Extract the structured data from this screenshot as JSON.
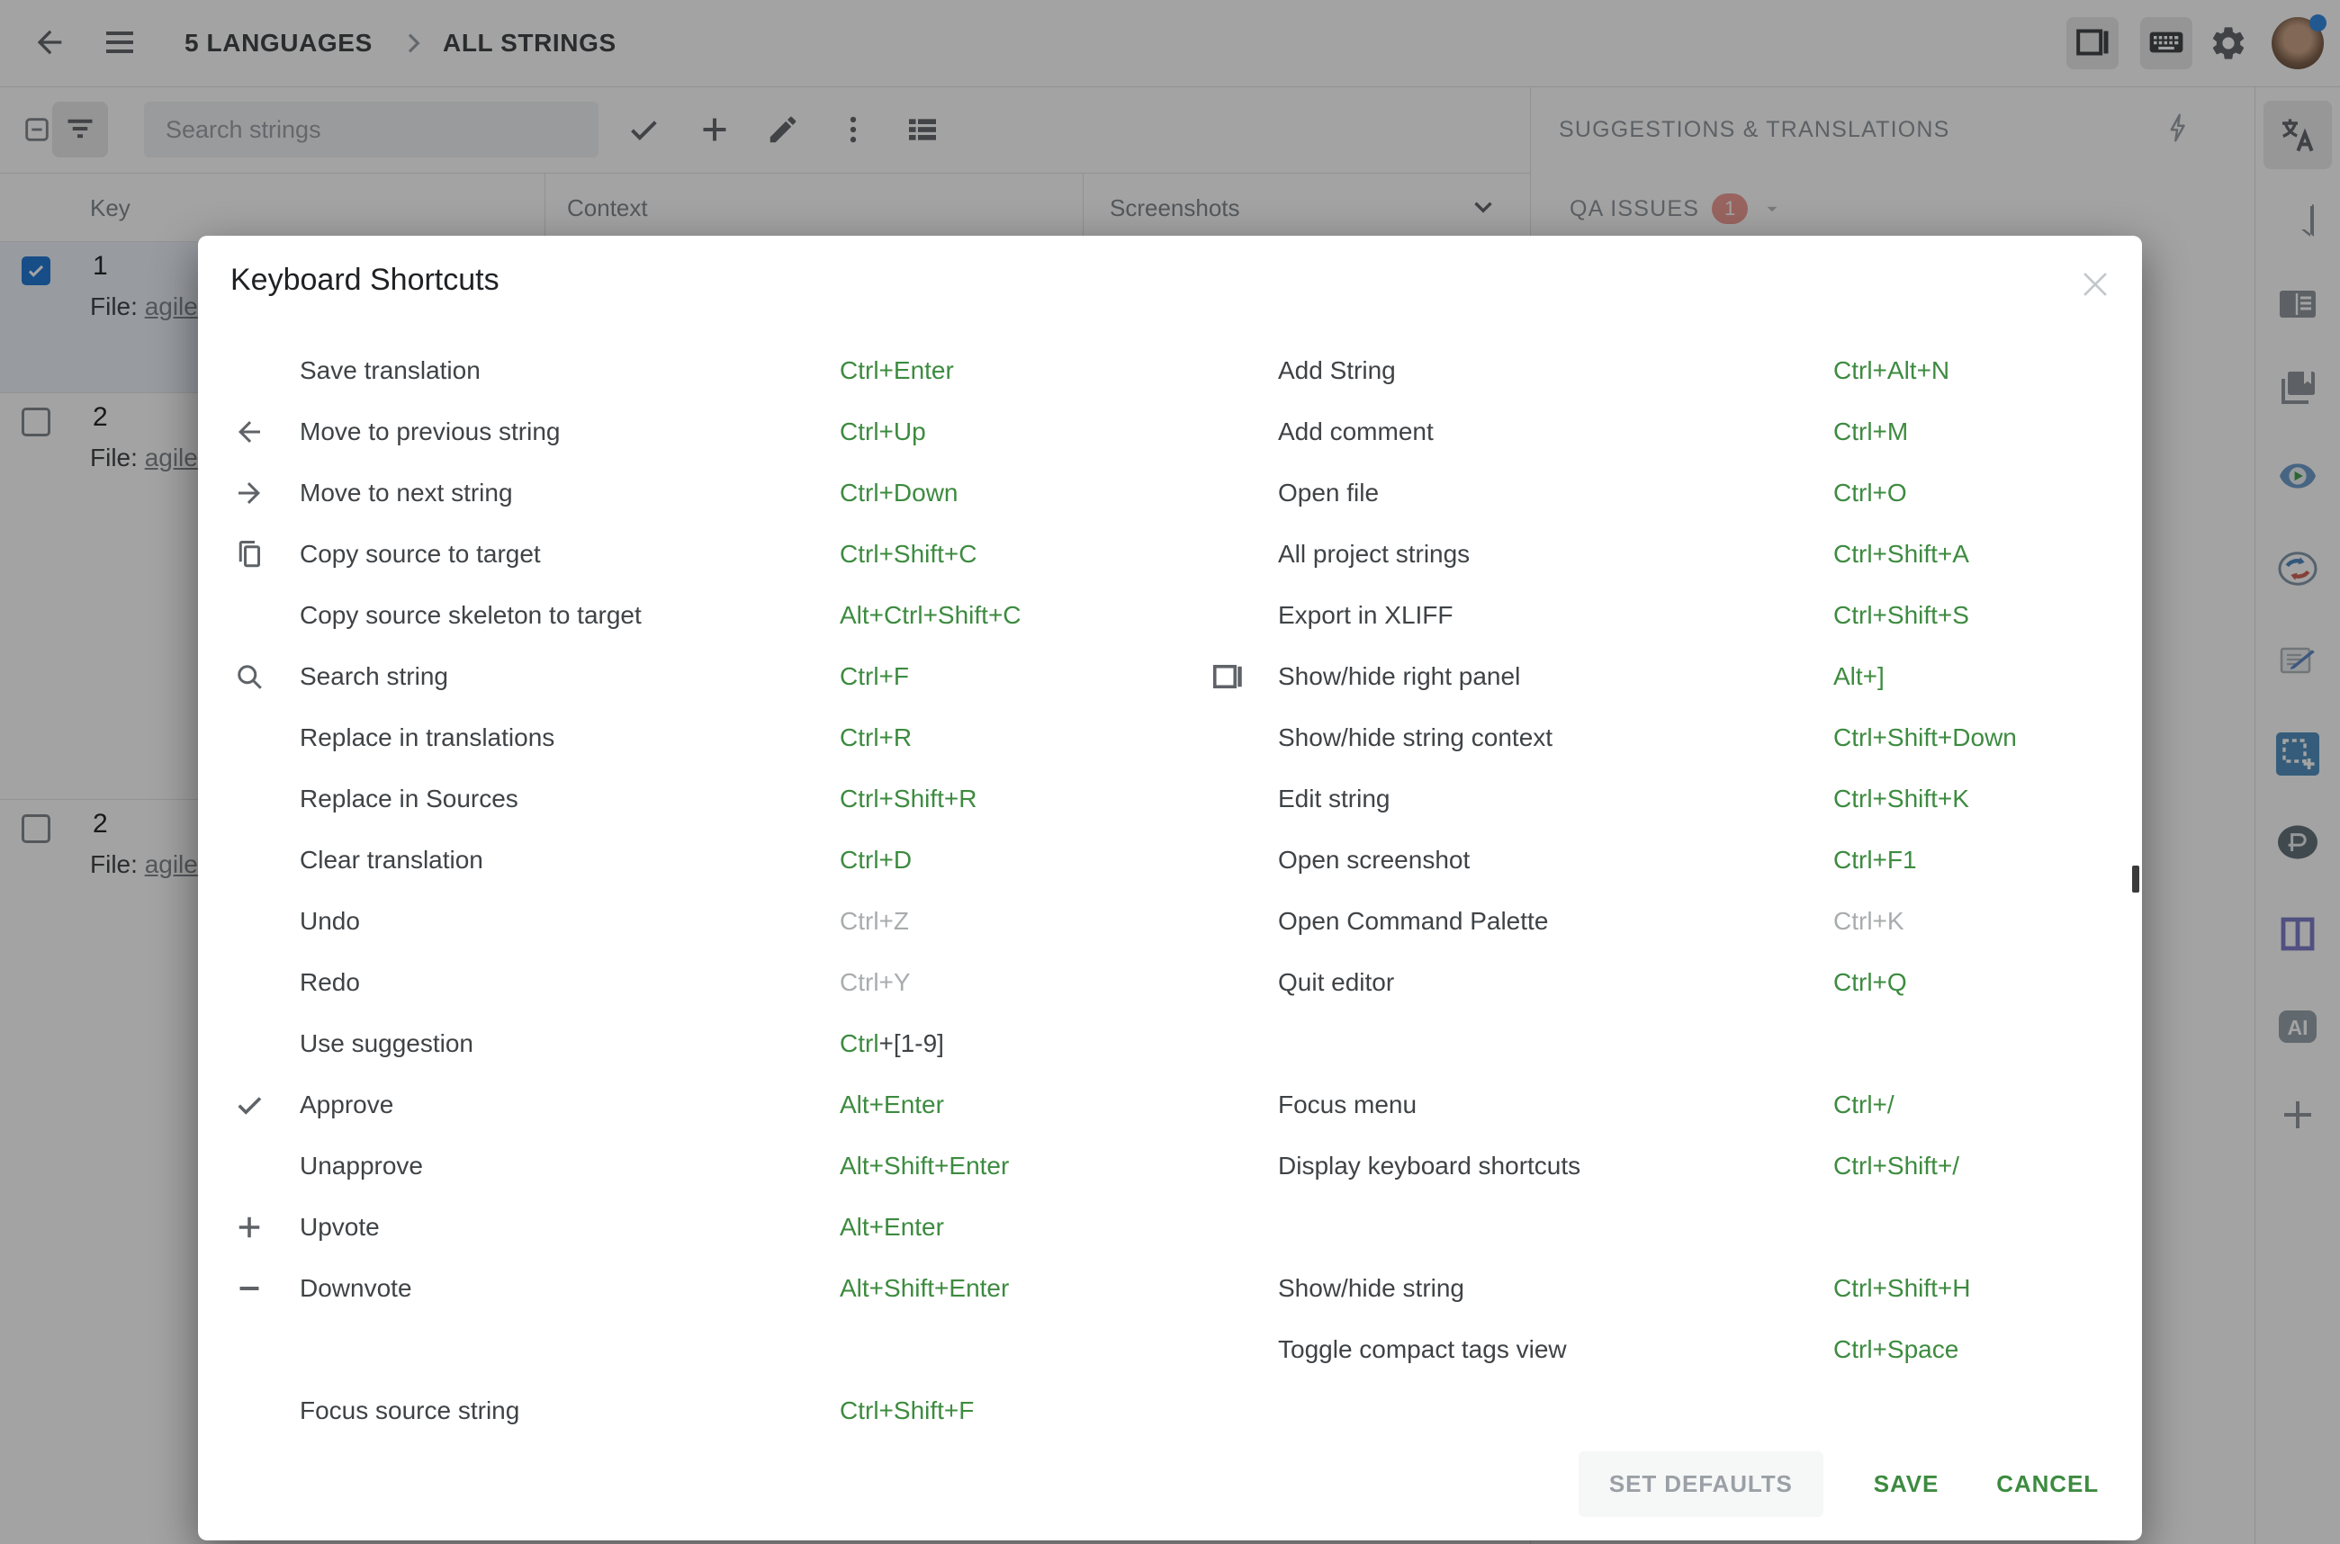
{
  "header": {
    "breadcrumb": {
      "project": "5 LANGUAGES",
      "section": "ALL STRINGS"
    },
    "action_icons": [
      "back-arrow-icon",
      "hamburger-icon",
      "panel-toggle-icon",
      "keyboard-icon",
      "gear-icon",
      "avatar"
    ]
  },
  "toolbar": {
    "search_placeholder": "Search strings",
    "icons": [
      "indeterminate-checkbox-icon",
      "filter-icon",
      "check-icon",
      "plus-icon",
      "pencil-icon",
      "more-vert-icon",
      "view-list-icon"
    ]
  },
  "table": {
    "columns": [
      "Key",
      "Context",
      "Screenshots"
    ],
    "rows": [
      {
        "key": "1",
        "file_label": "File:",
        "file_link": "agile",
        "checked": true,
        "selected": true
      },
      {
        "key": "2",
        "file_label": "File:",
        "file_link": "agile",
        "checked": false,
        "selected": false
      },
      {
        "key": "2",
        "file_label": "File:",
        "file_link": "agile",
        "checked": false,
        "selected": false
      }
    ]
  },
  "right_panel": {
    "title": "SUGGESTIONS & TRANSLATIONS",
    "pin_icon": "lightning-icon",
    "qa_label": "QA ISSUES",
    "qa_count": "1"
  },
  "sidebar": {
    "icons": [
      {
        "name": "translate-icon",
        "active": true
      },
      {
        "name": "comment-icon"
      },
      {
        "name": "article-icon"
      },
      {
        "name": "book-icon"
      },
      {
        "name": "eye-play-icon"
      },
      {
        "name": "sync-icon"
      },
      {
        "name": "compose-icon"
      },
      {
        "name": "screenshot-icon"
      },
      {
        "name": "proofread-icon"
      },
      {
        "name": "columns-icon"
      },
      {
        "name": "ai-icon"
      },
      {
        "name": "add-icon"
      }
    ]
  },
  "modal": {
    "title": "Keyboard Shortcuts",
    "close_icon": "close-icon",
    "columns": {
      "left": [
        {
          "label": "Save translation",
          "keys": "Ctrl+Enter"
        },
        {
          "icon": "arrow-left-icon",
          "label": "Move to previous string",
          "keys": "Ctrl+Up"
        },
        {
          "icon": "arrow-right-icon",
          "label": "Move to next string",
          "keys": "Ctrl+Down"
        },
        {
          "icon": "copy-icon",
          "label": "Copy source to target",
          "keys": "Ctrl+Shift+C"
        },
        {
          "label": "Copy source skeleton to target",
          "keys": "Alt+Ctrl+Shift+C"
        },
        {
          "icon": "search-icon",
          "label": "Search string",
          "keys": "Ctrl+F"
        },
        {
          "label": "Replace in translations",
          "keys": "Ctrl+R"
        },
        {
          "label": "Replace in Sources",
          "keys": "Ctrl+Shift+R"
        },
        {
          "label": "Clear translation",
          "keys": "Ctrl+D"
        },
        {
          "label": "Undo",
          "keys": "Ctrl+Z",
          "muted": true
        },
        {
          "label": "Redo",
          "keys": "Ctrl+Y",
          "muted": true
        },
        {
          "label": "Use suggestion",
          "keys": "Ctrl",
          "keys_suffix": "+[1-9]"
        },
        {
          "icon": "check-icon",
          "label": "Approve",
          "keys": "Alt+Enter"
        },
        {
          "label": "Unapprove",
          "keys": "Alt+Shift+Enter"
        },
        {
          "icon": "plus-icon",
          "label": "Upvote",
          "keys": "Alt+Enter"
        },
        {
          "icon": "minus-icon",
          "label": "Downvote",
          "keys": "Alt+Shift+Enter"
        },
        {
          "spacer": true
        },
        {
          "label": "Focus source string",
          "keys": "Ctrl+Shift+F"
        }
      ],
      "right": [
        {
          "label": "Add String",
          "keys": "Ctrl+Alt+N"
        },
        {
          "label": "Add comment",
          "keys": "Ctrl+M"
        },
        {
          "label": "Open file",
          "keys": "Ctrl+O"
        },
        {
          "label": "All project strings",
          "keys": "Ctrl+Shift+A"
        },
        {
          "label": "Export in XLIFF",
          "keys": "Ctrl+Shift+S"
        },
        {
          "icon": "panel-right-icon",
          "label": "Show/hide right panel",
          "keys": "Alt+]"
        },
        {
          "label": "Show/hide string context",
          "keys": "Ctrl+Shift+Down"
        },
        {
          "label": "Edit string",
          "keys": "Ctrl+Shift+K"
        },
        {
          "label": "Open screenshot",
          "keys": "Ctrl+F1"
        },
        {
          "label": "Open Command Palette",
          "keys": "Ctrl+K",
          "muted": true
        },
        {
          "label": "Quit editor",
          "keys": "Ctrl+Q"
        },
        {
          "spacer": true
        },
        {
          "label": "Focus menu",
          "keys": "Ctrl+/"
        },
        {
          "label": "Display keyboard shortcuts",
          "keys": "Ctrl+Shift+/"
        },
        {
          "spacer": true
        },
        {
          "label": "Show/hide string",
          "keys": "Ctrl+Shift+H"
        },
        {
          "label": "Toggle compact tags view",
          "keys": "Ctrl+Space"
        }
      ]
    },
    "footer": {
      "set_defaults": "SET DEFAULTS",
      "save": "SAVE",
      "cancel": "CANCEL"
    }
  },
  "colors": {
    "accent_green": "#3d8b40",
    "muted_key": "#a9acae",
    "checkbox_blue": "#1d76d2",
    "badge_red": "#ef9a91",
    "presence_blue": "#2f87e0"
  }
}
